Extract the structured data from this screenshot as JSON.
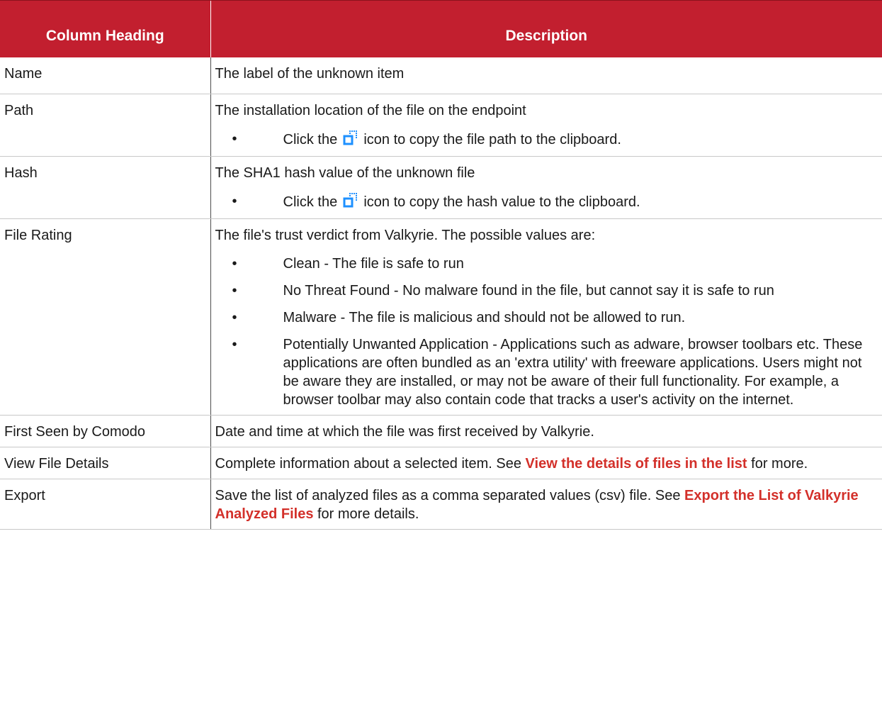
{
  "headers": {
    "col1": "Column Heading",
    "col2": "Description"
  },
  "colors": {
    "header_bg": "#c21f2f",
    "link": "#d3302a",
    "icon": "#1e90ff"
  },
  "rows": {
    "name": {
      "heading": "Name",
      "desc": "The label of the unknown item"
    },
    "path": {
      "heading": "Path",
      "desc": "The installation location of the file on the endpoint",
      "bullet_pre": "Click the",
      "bullet_post": "icon to copy the file path to the clipboard.",
      "icon": "copy-icon"
    },
    "hash": {
      "heading": "Hash",
      "desc": "The SHA1 hash value of the unknown file",
      "bullet_pre": "Click the",
      "bullet_post": "icon to copy the hash value to the clipboard.",
      "icon": "copy-icon"
    },
    "rating": {
      "heading": "File Rating",
      "desc": "The file's trust verdict from Valkyrie. The possible values are:",
      "bullets": [
        "Clean - The file is safe to run",
        "No Threat Found - No malware found in the file, but cannot say it is safe to run",
        "Malware - The file is malicious and should not be allowed to run.",
        "Potentially Unwanted Application - Applications such as adware, browser toolbars etc. These applications are often bundled as an 'extra utility' with freeware applications. Users might not be aware they are installed, or may not be aware of their full functionality. For example, a browser toolbar may also contain code that tracks a user's activity on the internet."
      ]
    },
    "first_seen": {
      "heading": "First Seen by Comodo",
      "desc": "Date and time at which the file was first received by Valkyrie."
    },
    "view_details": {
      "heading": "View File Details",
      "desc_pre": "Complete information about a selected item. See",
      "link": "View the details of files in the list",
      "desc_post": "for more."
    },
    "export": {
      "heading": "Export",
      "desc_pre": "Save the list of analyzed files as a comma separated values (csv) file. See",
      "link": "Export the List of Valkyrie Analyzed Files",
      "desc_post": "for more details."
    }
  }
}
